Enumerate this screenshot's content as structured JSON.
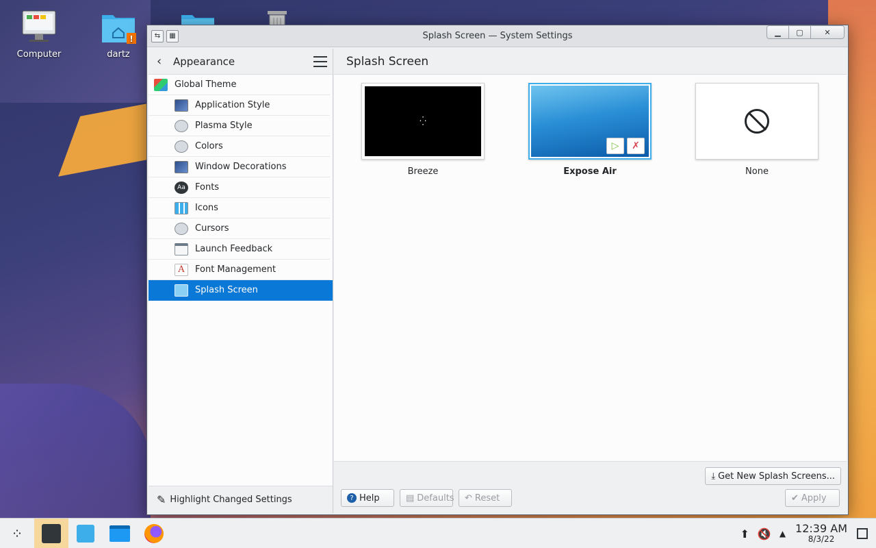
{
  "desktop": {
    "icons": [
      {
        "label": "Computer"
      },
      {
        "label": "dartz"
      },
      {
        "label": ""
      },
      {
        "label": ""
      }
    ]
  },
  "window": {
    "title": "Splash Screen — System Settings"
  },
  "sidebar": {
    "header": "Appearance",
    "items": [
      {
        "label": "Global Theme"
      },
      {
        "label": "Application Style"
      },
      {
        "label": "Plasma Style"
      },
      {
        "label": "Colors"
      },
      {
        "label": "Window Decorations"
      },
      {
        "label": "Fonts"
      },
      {
        "label": "Icons"
      },
      {
        "label": "Cursors"
      },
      {
        "label": "Launch Feedback"
      },
      {
        "label": "Font Management"
      },
      {
        "label": "Splash Screen"
      }
    ],
    "footer": "Highlight Changed Settings"
  },
  "main": {
    "title": "Splash Screen",
    "themes": [
      {
        "name": "Breeze"
      },
      {
        "name": "Expose Air"
      },
      {
        "name": "None"
      }
    ],
    "get_new": "Get New Splash Screens...",
    "help": "Help",
    "defaults": "Defaults",
    "reset": "Reset",
    "apply": "Apply"
  },
  "taskbar": {
    "time": "12:39 AM",
    "date": "8/3/22"
  },
  "colors": {
    "accent": "#0a78d6",
    "selection_border": "#3daee9"
  }
}
